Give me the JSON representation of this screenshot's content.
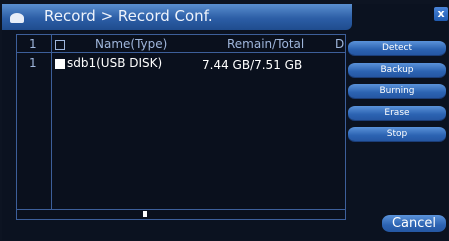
{
  "window": {
    "title": "Record > Record Conf.",
    "close_label": "x"
  },
  "table": {
    "headers": {
      "index": "1",
      "name": "Name(Type)",
      "remain_total": "Remain/Total",
      "extra": "D"
    },
    "rows": [
      {
        "index": "1",
        "name": "sdb1(USB DISK)",
        "remain_total": "7.44 GB/7.51 GB"
      }
    ]
  },
  "buttons": {
    "detect": "Detect",
    "backup": "Backup",
    "burning": "Burning",
    "erase": "Erase",
    "stop": "Stop",
    "cancel": "Cancel"
  }
}
